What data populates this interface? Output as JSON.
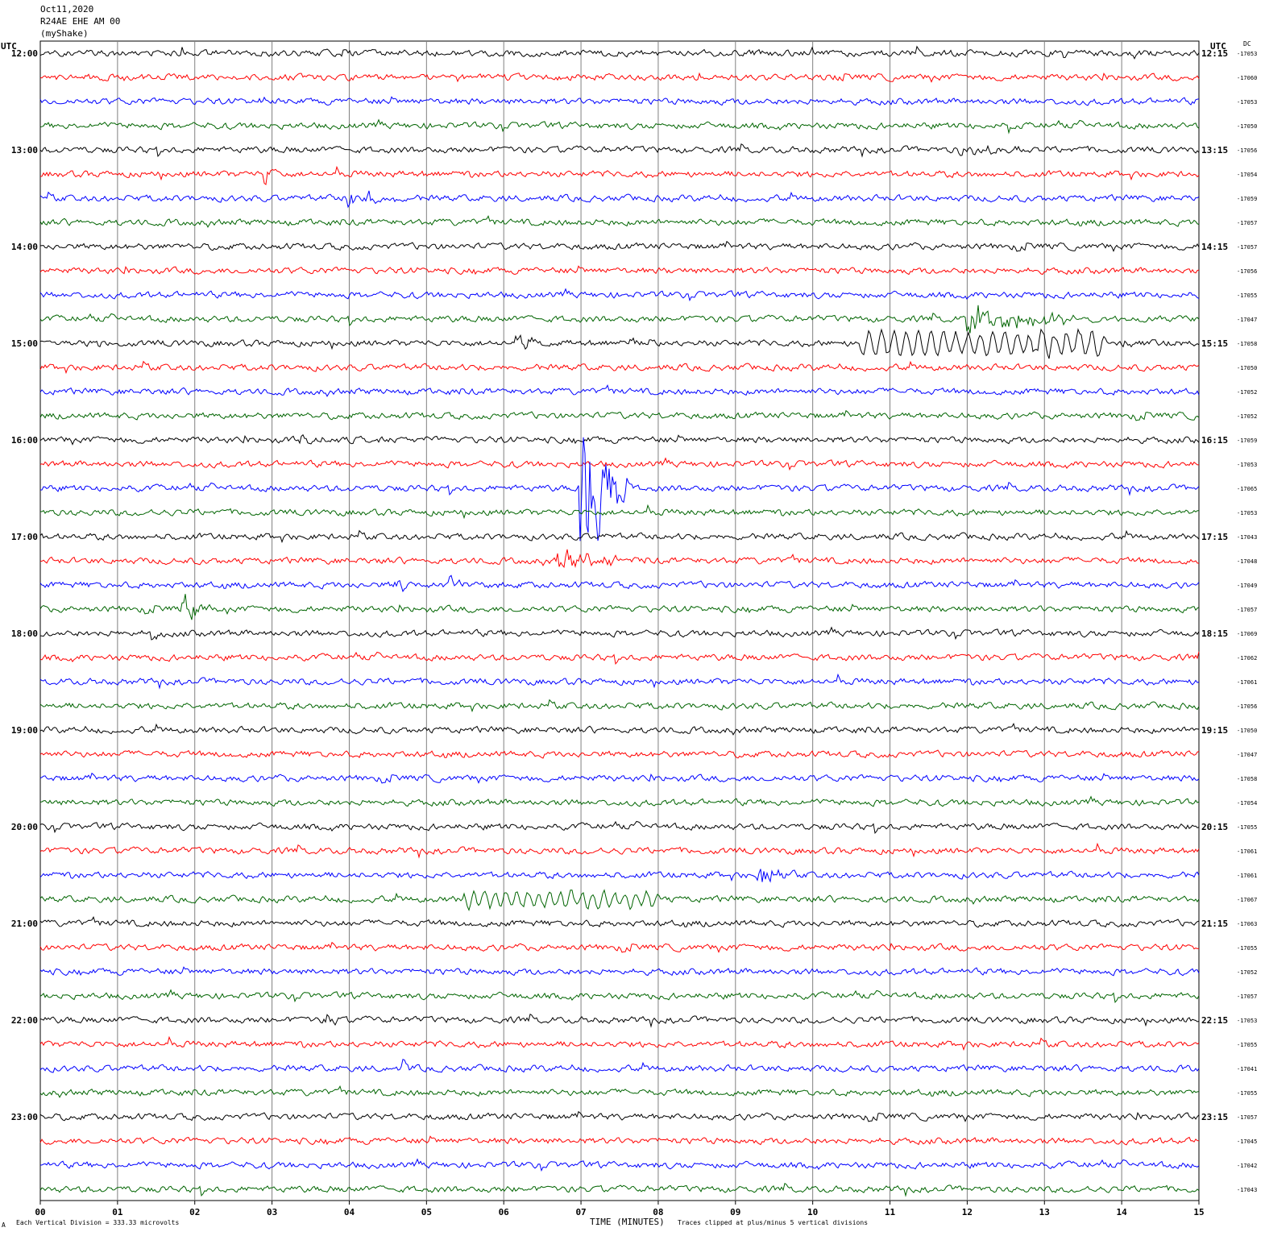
{
  "header": {
    "date": "Oct11,2020",
    "station": "R24AE EHE AM 00",
    "network": "(myShake)"
  },
  "labels": {
    "utc_left": "UTC",
    "utc_right": "UTC",
    "dc": "DC",
    "xlabel": "TIME (MINUTES)",
    "division_note": "Each Vertical Division =  333.33 microvolts",
    "clip_note": "Traces clipped at plus/minus 5 vertical divisions",
    "corner_mark": "A"
  },
  "colors": {
    "black": "#000000",
    "red": "#ff0000",
    "blue": "#0000ff",
    "green": "#006400",
    "grid": "#808080"
  },
  "chart_data": {
    "type": "line",
    "title": "R24AE EHE AM 00",
    "xlabel": "TIME (MINUTES)",
    "xlim": [
      0,
      15
    ],
    "x_ticks": [
      "00",
      "01",
      "02",
      "03",
      "04",
      "05",
      "06",
      "07",
      "08",
      "09",
      "10",
      "11",
      "12",
      "13",
      "14",
      "15"
    ],
    "trace_color_cycle": [
      "black",
      "red",
      "blue",
      "green"
    ],
    "hour_labels_left": [
      "12:00",
      "13:00",
      "14:00",
      "15:00",
      "16:00",
      "17:00",
      "18:00",
      "19:00",
      "20:00",
      "21:00",
      "22:00",
      "23:00"
    ],
    "hour_labels_right": [
      "12:15",
      "13:15",
      "14:15",
      "15:15",
      "16:15",
      "17:15",
      "18:15",
      "19:15",
      "20:15",
      "21:15",
      "22:15",
      "23:15"
    ],
    "dc_offsets": [
      "-17053",
      "-17060",
      "-17053",
      "-17050",
      "-17056",
      "-17054",
      "-17059",
      "-17057",
      "-17057",
      "-17056",
      "-17055",
      "-17047",
      "-17058",
      "-17050",
      "-17052",
      "-17052",
      "-17059",
      "-17053",
      "-17065",
      "-17053",
      "-17043",
      "-17048",
      "-17049",
      "-17057",
      "-17069",
      "-17062",
      "-17061",
      "-17056",
      "-17050",
      "-17047",
      "-17058",
      "-17054",
      "-17055",
      "-17061",
      "-17061",
      "-17067",
      "-17063",
      "-17055",
      "-17052",
      "-17057",
      "-17053",
      "-17055",
      "-17041",
      "-17055",
      "-17057",
      "-17045",
      "-17042",
      "-17043"
    ],
    "events": [
      {
        "trace": 2,
        "minute": 2.8,
        "amp": 12,
        "dur": 0.12
      },
      {
        "trace": 3,
        "minute": 12.5,
        "amp": 12,
        "dur": 0.1
      },
      {
        "trace": 4,
        "minute": 11.9,
        "amp": 6,
        "dur": 0.9
      },
      {
        "trace": 5,
        "minute": 2.9,
        "amp": 14,
        "dur": 0.2
      },
      {
        "trace": 6,
        "minute": 4.0,
        "amp": 14,
        "dur": 0.6
      },
      {
        "trace": 11,
        "minute": 12.0,
        "amp": 18,
        "dur": 1.4
      },
      {
        "trace": 12,
        "minute": 6.2,
        "amp": 12,
        "dur": 0.3
      },
      {
        "trace": 12,
        "minute": 7.6,
        "amp": 12,
        "dur": 0.3
      },
      {
        "trace": 12,
        "minute": 10.6,
        "amp": 11,
        "dur": 3.2,
        "period": 0.16
      },
      {
        "trace": 12,
        "minute": 12.8,
        "amp": 8,
        "dur": 1.6
      },
      {
        "trace": 16,
        "minute": 3.3,
        "amp": 9,
        "dur": 0.5
      },
      {
        "trace": 18,
        "minute": 7.0,
        "amp": 95,
        "dur": 0.6
      },
      {
        "trace": 21,
        "minute": 6.7,
        "amp": 18,
        "dur": 0.8
      },
      {
        "trace": 22,
        "minute": 4.6,
        "amp": 14,
        "dur": 0.2
      },
      {
        "trace": 22,
        "minute": 5.3,
        "amp": 12,
        "dur": 0.2
      },
      {
        "trace": 23,
        "minute": 1.85,
        "amp": 14,
        "dur": 0.35
      },
      {
        "trace": 24,
        "minute": 1.4,
        "amp": 10,
        "dur": 0.2
      },
      {
        "trace": 34,
        "minute": 9.3,
        "amp": 11,
        "dur": 0.5
      },
      {
        "trace": 35,
        "minute": 5.5,
        "amp": 8,
        "dur": 2.5,
        "period": 0.14
      },
      {
        "trace": 40,
        "minute": 3.7,
        "amp": 10,
        "dur": 0.2
      },
      {
        "trace": 42,
        "minute": 4.7,
        "amp": 12,
        "dur": 0.1
      }
    ]
  }
}
